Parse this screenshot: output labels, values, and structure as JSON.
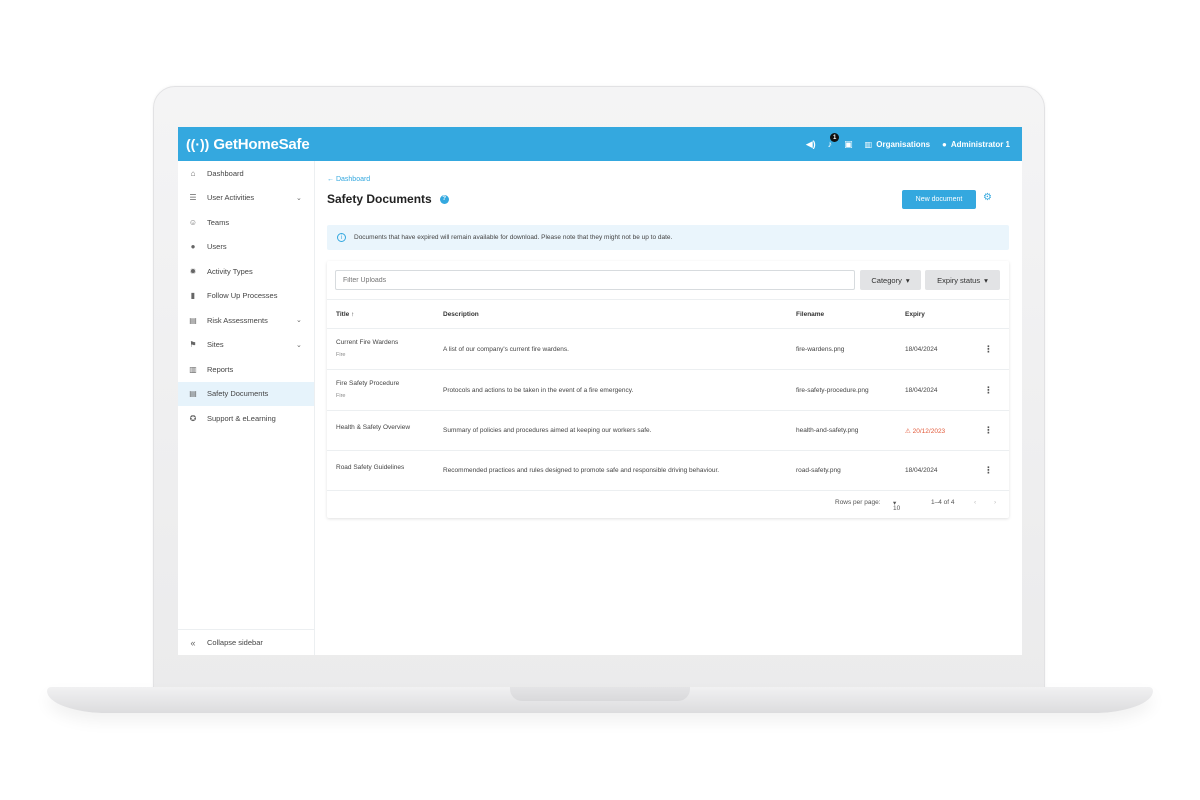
{
  "topbar": {
    "brand": "GetHomeSafe",
    "notification_count": "1",
    "organisations_label": "Organisations",
    "user_label": "Administrator 1"
  },
  "sidebar": {
    "items": [
      {
        "label": "Dashboard",
        "icon": "home-icon",
        "chevron": false
      },
      {
        "label": "User Activities",
        "icon": "list-icon",
        "chevron": true
      },
      {
        "label": "Teams",
        "icon": "team-icon",
        "chevron": false
      },
      {
        "label": "Users",
        "icon": "user-icon",
        "chevron": false
      },
      {
        "label": "Activity Types",
        "icon": "gear-icon",
        "chevron": false
      },
      {
        "label": "Follow Up Processes",
        "icon": "clipboard-icon",
        "chevron": false
      },
      {
        "label": "Risk Assessments",
        "icon": "document-icon",
        "chevron": true
      },
      {
        "label": "Sites",
        "icon": "sites-icon",
        "chevron": true
      },
      {
        "label": "Reports",
        "icon": "chart-icon",
        "chevron": false
      },
      {
        "label": "Safety Documents",
        "icon": "document-icon",
        "chevron": false,
        "active": true
      },
      {
        "label": "Support & eLearning",
        "icon": "support-icon",
        "chevron": false
      }
    ],
    "collapse_label": "Collapse sidebar"
  },
  "main": {
    "back_label": "Dashboard",
    "title": "Safety Documents",
    "new_document_label": "New document",
    "info_text": "Documents that have expired will remain available for download. Please note that they might not be up to date.",
    "filter_placeholder": "Filter Uploads",
    "category_label": "Category",
    "expiry_label": "Expiry status",
    "columns": {
      "title": "Title",
      "description": "Description",
      "filename": "Filename",
      "expiry": "Expiry"
    },
    "rows": [
      {
        "title": "Current Fire Wardens",
        "category": "Fire",
        "description": "A list of our company's current fire wardens.",
        "filename": "fire-wardens.png",
        "expiry": "18/04/2024",
        "expired": false
      },
      {
        "title": "Fire Safety Procedure",
        "category": "Fire",
        "description": "Protocols and actions to be taken in the event of a fire emergency.",
        "filename": "fire-safety-procedure.png",
        "expiry": "18/04/2024",
        "expired": false
      },
      {
        "title": "Health & Safety Overview",
        "category": "",
        "description": "Summary of policies and procedures aimed at keeping our workers safe.",
        "filename": "health-and-safety.png",
        "expiry": "20/12/2023",
        "expired": true
      },
      {
        "title": "Road Safety Guidelines",
        "category": "",
        "description": "Recommended practices and rules designed to promote safe and responsible driving behaviour.",
        "filename": "road-safety.png",
        "expiry": "18/04/2024",
        "expired": false
      }
    ],
    "pager": {
      "rows_per_page_label": "Rows per page:",
      "rows_per_page": "10",
      "range": "1–4 of 4"
    }
  },
  "colors": {
    "accent": "#34a8df",
    "expired": "#e25a3a"
  }
}
